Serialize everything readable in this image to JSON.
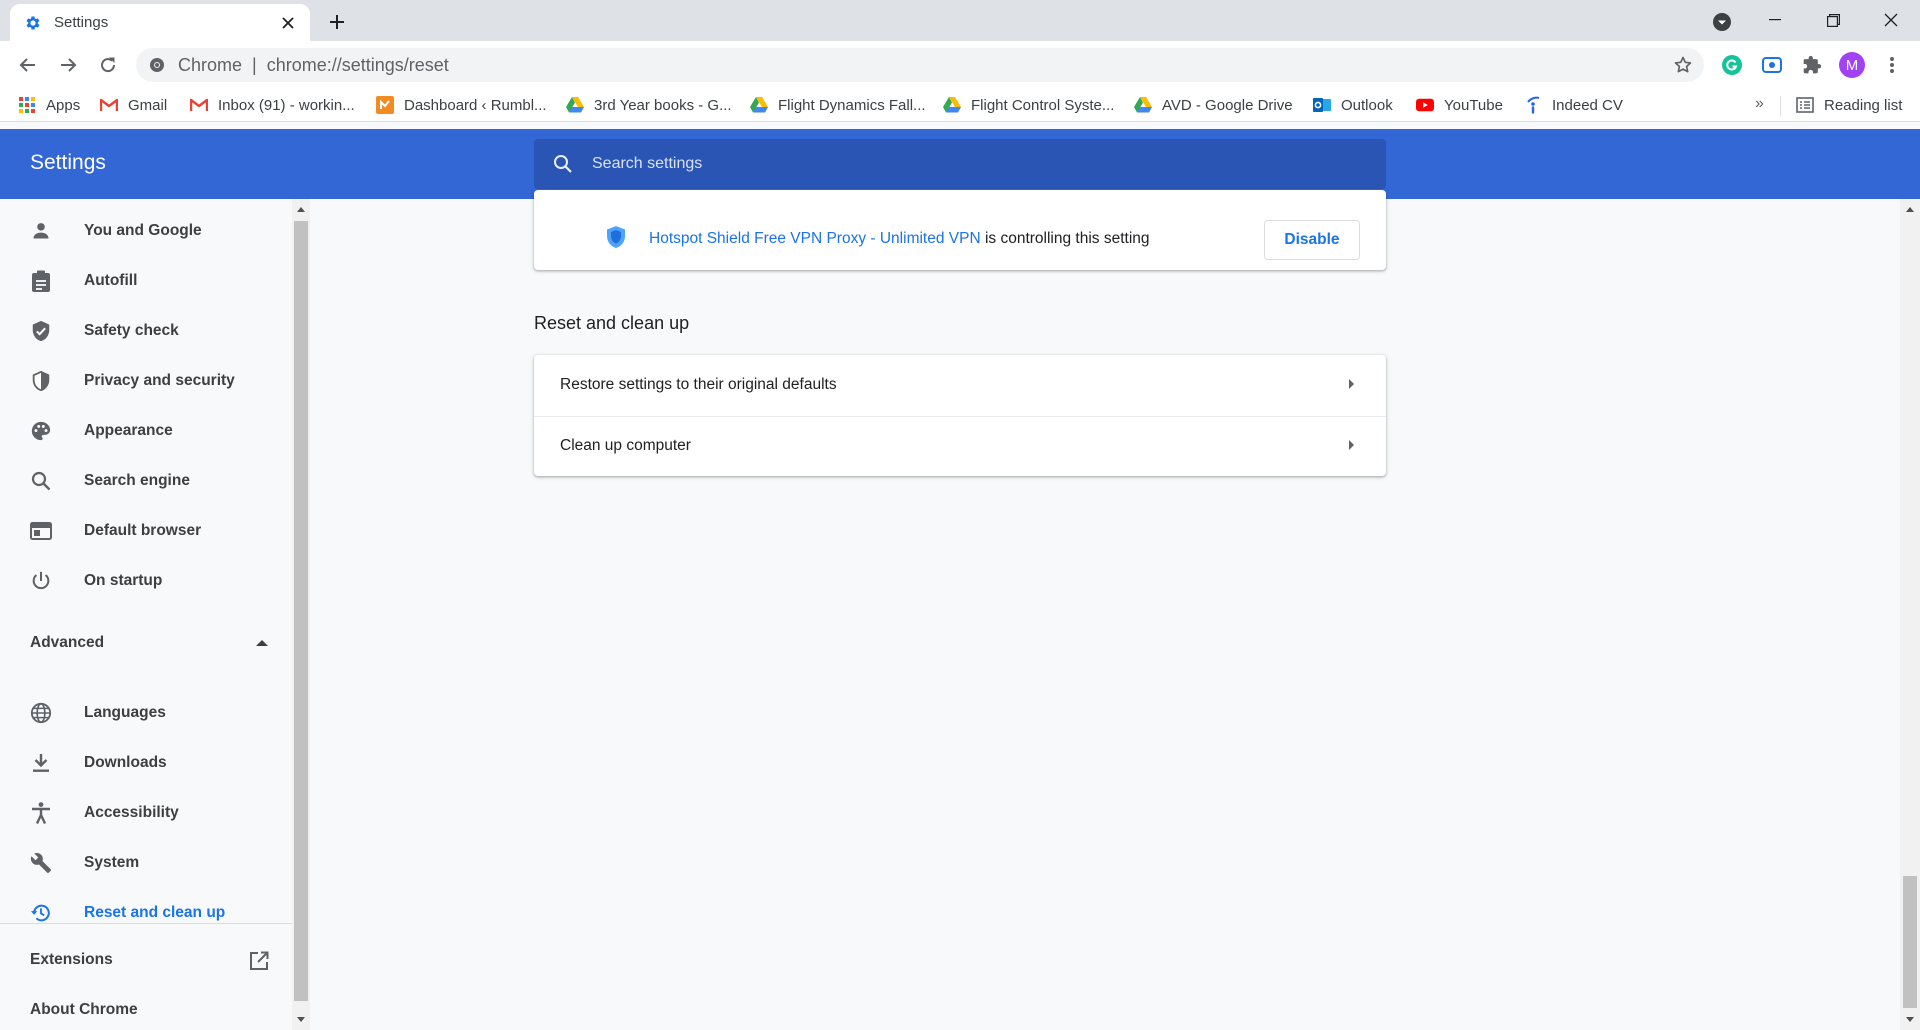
{
  "browser": {
    "tab_title": "Settings",
    "omnibox": {
      "origin": "Chrome",
      "separator": "|",
      "url": "chrome://settings/reset"
    },
    "profile_initial": "M"
  },
  "bookmarks": [
    {
      "label": "Apps",
      "icon": "apps-grid-icon"
    },
    {
      "label": "Gmail",
      "icon": "gmail-icon"
    },
    {
      "label": "Inbox (91) - workin...",
      "icon": "gmail-icon"
    },
    {
      "label": "Dashboard ‹ Rumbl...",
      "icon": "dashboard-icon"
    },
    {
      "label": "3rd Year books - G...",
      "icon": "google-drive-icon"
    },
    {
      "label": "Flight Dynamics Fall...",
      "icon": "google-drive-icon"
    },
    {
      "label": "Flight Control Syste...",
      "icon": "google-drive-icon"
    },
    {
      "label": "AVD - Google Drive",
      "icon": "google-drive-icon"
    },
    {
      "label": "Outlook",
      "icon": "outlook-icon"
    },
    {
      "label": "YouTube",
      "icon": "youtube-icon"
    },
    {
      "label": "Indeed CV",
      "icon": "indeed-icon"
    }
  ],
  "bookmarks_more": "»",
  "reading_list": "Reading list",
  "header": {
    "title": "Settings",
    "search_placeholder": "Search settings"
  },
  "sidebar": {
    "items": [
      {
        "label": "You and Google",
        "icon": "person-icon"
      },
      {
        "label": "Autofill",
        "icon": "clipboard-icon"
      },
      {
        "label": "Safety check",
        "icon": "shield-check-icon"
      },
      {
        "label": "Privacy and security",
        "icon": "shield-half-icon"
      },
      {
        "label": "Appearance",
        "icon": "palette-icon"
      },
      {
        "label": "Search engine",
        "icon": "search-icon"
      },
      {
        "label": "Default browser",
        "icon": "browser-window-icon"
      },
      {
        "label": "On startup",
        "icon": "power-icon"
      }
    ],
    "advanced_label": "Advanced",
    "advanced_items": [
      {
        "label": "Languages",
        "icon": "globe-icon"
      },
      {
        "label": "Downloads",
        "icon": "download-icon"
      },
      {
        "label": "Accessibility",
        "icon": "accessibility-icon"
      },
      {
        "label": "System",
        "icon": "wrench-icon"
      },
      {
        "label": "Reset and clean up",
        "icon": "restore-icon",
        "active": true
      }
    ],
    "extensions_label": "Extensions",
    "about_label": "About Chrome"
  },
  "main": {
    "extension_notice": {
      "extension_name": "Hotspot Shield Free VPN Proxy - Unlimited VPN",
      "suffix": " is controlling this setting",
      "button": "Disable"
    },
    "section_title": "Reset and clean up",
    "rows": [
      {
        "label": "Restore settings to their original defaults"
      },
      {
        "label": "Clean up computer"
      }
    ]
  },
  "colors": {
    "accent": "#1a73e8",
    "header_bg": "#3367d6",
    "search_bg": "#2a55b5"
  }
}
